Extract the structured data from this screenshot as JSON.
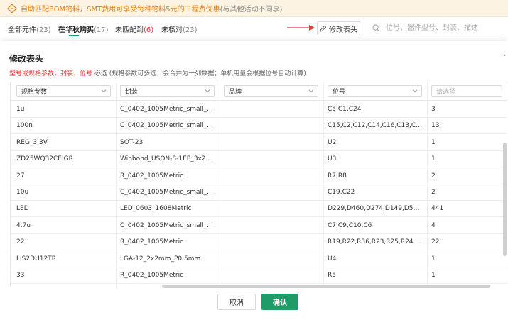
{
  "banner": {
    "text": "自助匹配BOM物料，SMT费用可享受每种物料5元的工程费优惠",
    "note": "(与其他活动不同享)",
    "icon": "coupon-icon",
    "color": "#e0821a"
  },
  "tabs": [
    {
      "label": "全部元件",
      "count": "(23)"
    },
    {
      "label": "在华秋购买",
      "count": "(17)"
    },
    {
      "label": "未匹配到",
      "count": "(6)"
    },
    {
      "label": "未核对",
      "count": "(23)"
    }
  ],
  "toolbar": {
    "edit_header_label": "修改表头",
    "search_placeholder": "位号、器件型号、封装、描述"
  },
  "modal": {
    "title": "修改表头",
    "hint_required": "型号或规格参数，封装，位号",
    "hint_must": "必选",
    "hint_tail": "(规格参数可多选，会合并为一列数据；单机用量会根据位号自动计算)",
    "columns": [
      {
        "value": "规格参数"
      },
      {
        "value": "封装"
      },
      {
        "value": "品牌"
      },
      {
        "value": "位号"
      },
      {
        "placeholder": "请选择"
      }
    ],
    "rows": [
      [
        "1u",
        "C_0402_1005Metric_small_pads",
        "",
        "C5,C1,C24",
        "3"
      ],
      [
        "100n",
        "C_0402_1005Metric_small_pads",
        "",
        "C15,C2,C12,C14,C16,C13,C17,···",
        "13"
      ],
      [
        "REG_3.3V",
        "SOT-23",
        "",
        "U2",
        "1"
      ],
      [
        "ZD25WQ32CEIGR",
        "Winbond_USON-8-1EP_3x2m···",
        "",
        "U3",
        "1"
      ],
      [
        "27",
        "R_0402_1005Metric",
        "",
        "R7,R8",
        "2"
      ],
      [
        "10u",
        "C_0402_1005Metric_small_pads",
        "",
        "C19,C22",
        "2"
      ],
      [
        "LED",
        "LED_0603_1608Metric",
        "",
        "D229,D460,D274,D149,D514,D···",
        "441"
      ],
      [
        "4.7u",
        "C_0402_1005Metric_small_pads",
        "",
        "C7,C9,C10,C6",
        "4"
      ],
      [
        "22",
        "R_0402_1005Metric",
        "",
        "R19,R22,R36,R23,R25,R24,R34,···",
        "22"
      ],
      [
        "LIS2DH12TR",
        "LGA-12_2x2mm_P0.5mm",
        "",
        "U4",
        "1"
      ],
      [
        "33",
        "R_0402_1005Metric",
        "",
        "R5",
        "1"
      ]
    ],
    "cancel_label": "取消",
    "confirm_label": "确认",
    "confirm_color": "#1f9b67"
  }
}
